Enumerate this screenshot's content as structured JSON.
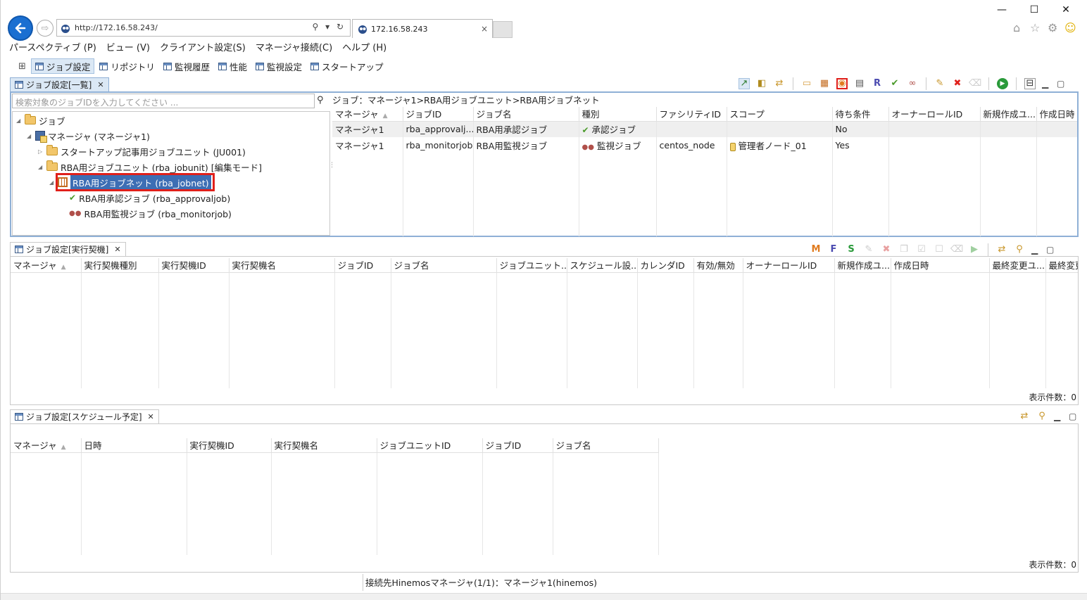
{
  "browser": {
    "url": "http://172.16.58.243/",
    "tab_title": "172.16.58.243",
    "tab_close": "×",
    "window_controls": [
      "—",
      "☐",
      "✕"
    ]
  },
  "menu": [
    "パースペクティブ (P)",
    "ビュー (V)",
    "クライアント設定(S)",
    "マネージャ接続(C)",
    "ヘルプ (H)"
  ],
  "perspectives": [
    "ジョブ設定",
    "リポジトリ",
    "監視履歴",
    "性能",
    "監視設定",
    "スタートアップ"
  ],
  "job_list_panel": {
    "tab_label": "ジョブ設定[一覧]",
    "search_placeholder": "検索対象のジョブIDを入力してください ...",
    "breadcrumb": "ジョブ：マネージャ1>RBA用ジョブユニット>RBA用ジョブネット",
    "tree": [
      {
        "label": "ジョブ",
        "icon": "folder-icon"
      },
      {
        "label": "マネージャ (マネージャ1)",
        "icon": "manager-icon"
      },
      {
        "label": "スタートアップ記事用ジョブユニット (JU001)",
        "icon": "folder-icon"
      },
      {
        "label": "RBA用ジョブユニット (rba_jobunit) [編集モード]",
        "icon": "folder-icon"
      },
      {
        "label": "RBA用ジョブネット (rba_jobnet)",
        "icon": "jobnet-icon",
        "selected": true
      },
      {
        "label": "RBA用承認ジョブ (rba_approvaljob)",
        "icon": "approval-icon"
      },
      {
        "label": "RBA用監視ジョブ (rba_monitorjob)",
        "icon": "monitor-icon"
      }
    ],
    "columns": [
      "マネージャ",
      "ジョブID",
      "ジョブ名",
      "種別",
      "ファシリティID",
      "スコープ",
      "待ち条件",
      "オーナーロールID",
      "新規作成ユ...",
      "作成日時"
    ],
    "rows": [
      [
        "マネージャ1",
        "rba_approvalj...",
        "RBA用承認ジョブ",
        "承認ジョブ",
        "",
        "",
        "No",
        "",
        "",
        ""
      ],
      [
        "マネージャ1",
        "rba_monitorjob",
        "RBA用監視ジョブ",
        "監視ジョブ",
        "centos_node",
        "管理者ノード_01",
        "Yes",
        "",
        "",
        ""
      ]
    ]
  },
  "trigger_panel": {
    "tab_label": "ジョブ設定[実行契機]",
    "columns": [
      "マネージャ",
      "実行契機種別",
      "実行契機ID",
      "実行契機名",
      "ジョブID",
      "ジョブ名",
      "ジョブユニット...",
      "スケジュール設...",
      "カレンダID",
      "有効/無効",
      "オーナーロールID",
      "新規作成ユ...",
      "作成日時",
      "最終変更ユ...",
      "最終変更"
    ],
    "count": "表示件数：0"
  },
  "schedule_panel": {
    "tab_label": "ジョブ設定[スケジュール予定]",
    "columns": [
      "マネージャ",
      "日時",
      "実行契機ID",
      "実行契機名",
      "ジョブユニットID",
      "ジョブID",
      "ジョブ名"
    ],
    "count": "表示件数：0"
  },
  "status_bar": "接続先Hinemosマネージャ(1/1)：マネージャ1(hinemos)",
  "colors": {
    "accent": "#1a6fd1",
    "selection": "#3d6eb4",
    "highlight_red": "#e0201b"
  }
}
